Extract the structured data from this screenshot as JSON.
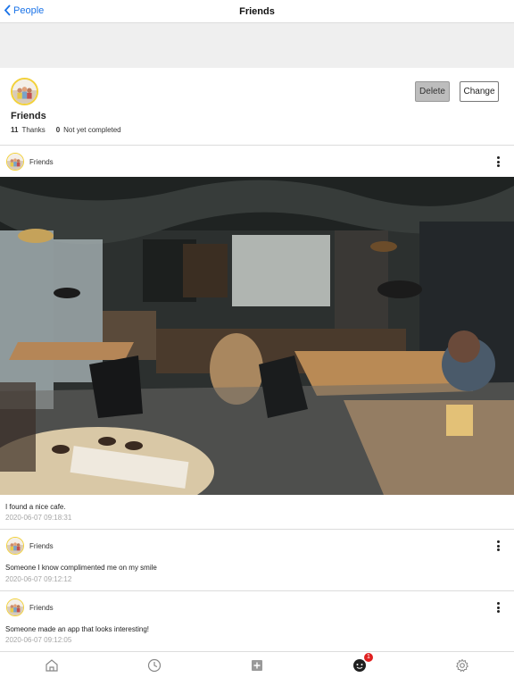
{
  "nav": {
    "back_label": "People",
    "title": "Friends"
  },
  "profile": {
    "name": "Friends",
    "thanks_count": "11",
    "thanks_label": "Thanks",
    "pending_count": "0",
    "pending_label": "Not yet completed",
    "delete_label": "Delete",
    "change_label": "Change"
  },
  "posts": [
    {
      "author": "Friends",
      "text": "I found a nice cafe.",
      "time": "2020-06-07 09:18:31"
    },
    {
      "author": "Friends",
      "text": "Someone I know complimented me on my smile",
      "time": "2020-06-07 09:12:12"
    },
    {
      "author": "Friends",
      "text": "Someone made an app that looks interesting!",
      "time": "2020-06-07 09:12:05"
    }
  ],
  "tabs": [
    {
      "icon": "home-icon"
    },
    {
      "icon": "clock-icon"
    },
    {
      "icon": "add-icon"
    },
    {
      "icon": "friends-icon",
      "badge": "1"
    },
    {
      "icon": "gear-icon"
    }
  ],
  "colors": {
    "accent": "#1a73e8",
    "avatar_ring": "#f2d13b",
    "badge": "#e02020"
  }
}
